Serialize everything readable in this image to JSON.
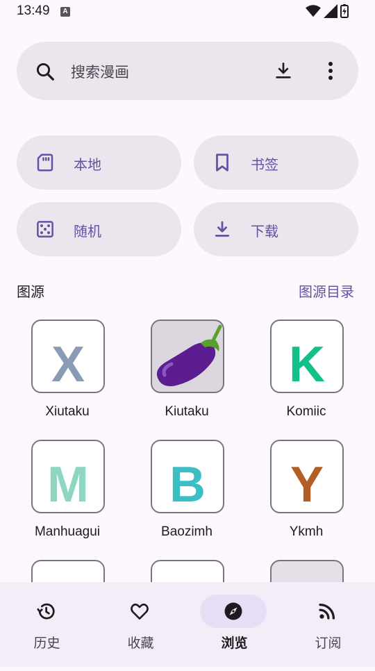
{
  "status_bar": {
    "time": "13:49",
    "indicator": "A"
  },
  "search": {
    "placeholder": "搜索漫画"
  },
  "quick_actions": [
    {
      "label": "本地",
      "icon": "sd-card-icon"
    },
    {
      "label": "书签",
      "icon": "bookmark-icon"
    },
    {
      "label": "随机",
      "icon": "dice-icon"
    },
    {
      "label": "下载",
      "icon": "download-icon"
    }
  ],
  "sources_section": {
    "title": "图源",
    "link": "图源目录"
  },
  "sources": [
    {
      "name": "Xiutaku",
      "letter": "X",
      "color": "#8a9bb6"
    },
    {
      "name": "Kiutaku",
      "letter": "",
      "color": "#5a1f8c"
    },
    {
      "name": "Komiic",
      "letter": "K",
      "color": "#14c08a"
    },
    {
      "name": "Manhuagui",
      "letter": "M",
      "color": "#8fd6c2"
    },
    {
      "name": "Baozimh",
      "letter": "B",
      "color": "#3bbfc4"
    },
    {
      "name": "Ykmh",
      "letter": "Y",
      "color": "#b35e24"
    }
  ],
  "bottom_nav": [
    {
      "label": "历史",
      "icon": "history-icon",
      "active": false
    },
    {
      "label": "收藏",
      "icon": "heart-icon",
      "active": false
    },
    {
      "label": "浏览",
      "icon": "compass-icon",
      "active": true
    },
    {
      "label": "订阅",
      "icon": "rss-icon",
      "active": false
    }
  ],
  "colors": {
    "accent": "#6750a4",
    "surface": "#ebe6ed",
    "background": "#fcf8fe",
    "nav_active": "#e8def8"
  }
}
